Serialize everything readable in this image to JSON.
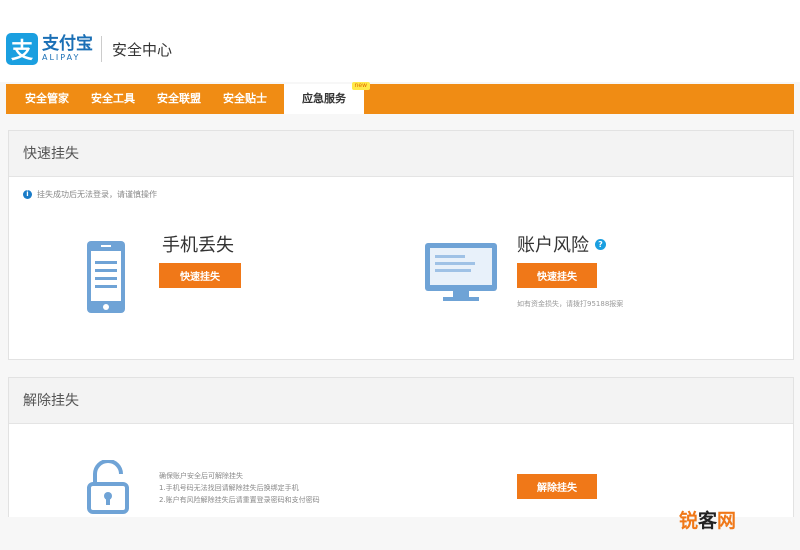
{
  "header": {
    "logo_mark": "支",
    "logo_cn": "支付宝",
    "logo_en": "ALIPAY",
    "title": "安全中心"
  },
  "nav": {
    "items": [
      "安全管家",
      "安全工具",
      "安全联盟",
      "安全贴士"
    ],
    "active": "应急服务",
    "active_badge": "new"
  },
  "quick_freeze": {
    "heading": "快速挂失",
    "notice": "挂失成功后无法登录，请谨慎操作",
    "phone": {
      "title": "手机丢失",
      "button": "快速挂失"
    },
    "account": {
      "title": "账户风险",
      "help": "?",
      "button": "快速挂失",
      "note": "如有资金损失，请拨打95188报案"
    }
  },
  "unfreeze": {
    "heading": "解除挂失",
    "desc_lines": [
      "确保账户安全后可解除挂失",
      "1.手机号码无法找回请解除挂失后换绑定手机",
      "2.账户有风险解除挂失后请重置登录密码和支付密码"
    ],
    "button": "解除挂失"
  },
  "watermark": {
    "part1": "锐",
    "part2": "客",
    "part3": "网"
  },
  "colors": {
    "nav_orange": "#f08c14",
    "button_orange": "#f07818",
    "brand_blue": "#1a9fe0",
    "icon_blue": "#6fa3d6"
  }
}
